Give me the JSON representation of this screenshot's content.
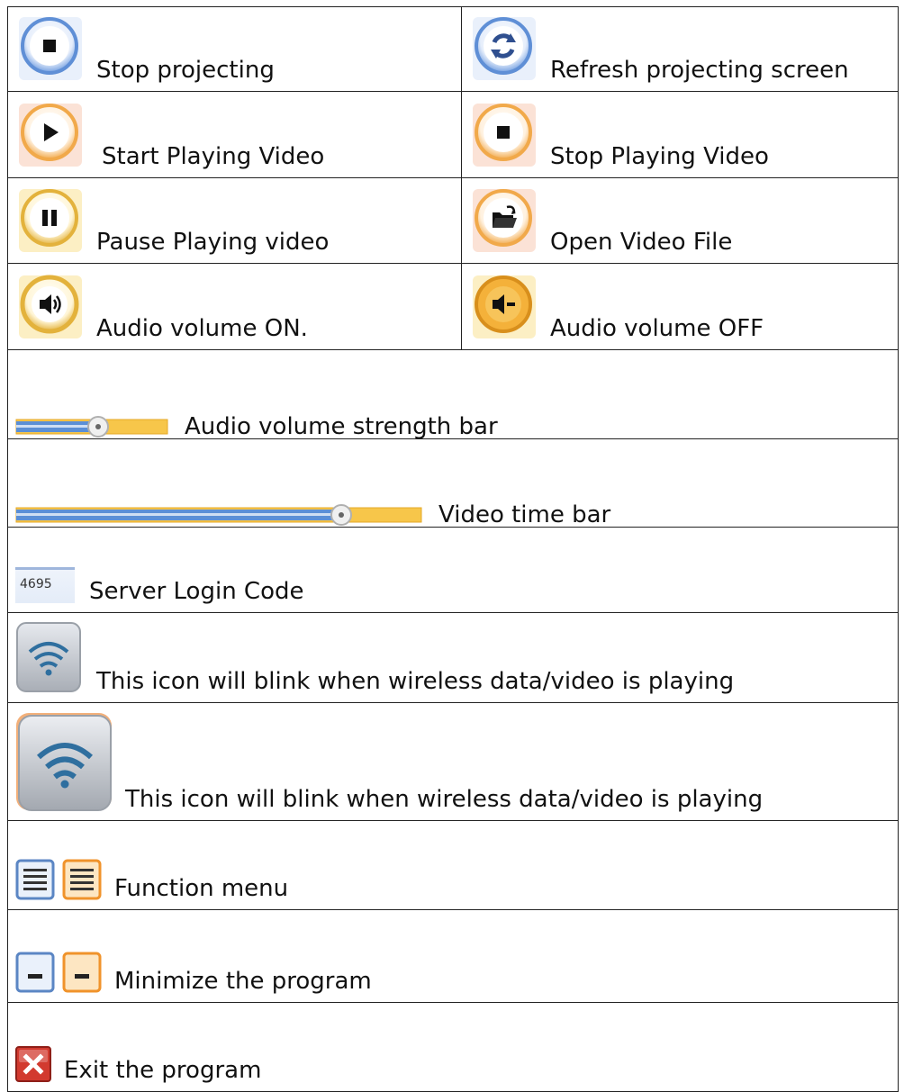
{
  "icon_legend": {
    "rows": [
      {
        "left": {
          "icon": "stop-projecting-icon",
          "label": "Stop projecting"
        },
        "right": {
          "icon": "refresh-projecting-icon",
          "label": "Refresh projecting screen"
        }
      },
      {
        "left": {
          "icon": "start-video-icon",
          "label": "Start Playing Video"
        },
        "right": {
          "icon": "stop-video-icon",
          "label": "Stop Playing Video"
        }
      },
      {
        "left": {
          "icon": "pause-video-icon",
          "label": "Pause Playing video"
        },
        "right": {
          "icon": "open-video-file-icon",
          "label": "Open Video File"
        }
      },
      {
        "left": {
          "icon": "audio-on-icon",
          "label": "Audio volume ON."
        },
        "right": {
          "icon": "audio-off-icon",
          "label": "Audio volume OFF"
        }
      }
    ],
    "full_rows": [
      {
        "icon": "volume-bar-icon",
        "label": "Audio volume strength bar",
        "slider_level": 0.55
      },
      {
        "icon": "time-bar-icon",
        "label": "Video time bar",
        "slider_level": 0.72
      },
      {
        "icon": "login-code-icon",
        "label": "Server Login Code",
        "code": "4695"
      },
      {
        "icon": "wireless-small-icon",
        "label": "This icon will blink when wireless data/video is playing"
      },
      {
        "icon": "wireless-large-icon",
        "label": "This icon will blink when wireless data/video is playing"
      },
      {
        "icon": "function-menu-icon",
        "label": "Function menu"
      },
      {
        "icon": "minimize-icon",
        "label": "Minimize the program"
      },
      {
        "icon": "exit-icon",
        "label": "Exit the program"
      }
    ]
  },
  "colors": {
    "blue_ring": "#5f8fd6",
    "orange_ring": "#f1a94a",
    "gold_ring": "#e3b23c",
    "bar_fill": "#5b8fd6",
    "bar_track": "#f7c64a",
    "exit_red": "#d23a2f"
  }
}
